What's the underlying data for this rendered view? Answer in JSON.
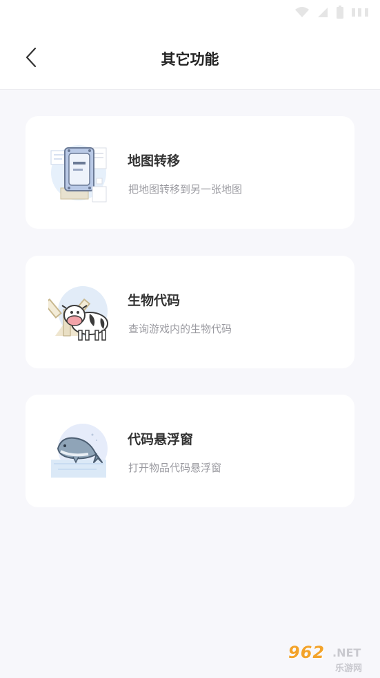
{
  "header": {
    "title": "其它功能"
  },
  "cards": [
    {
      "title": "地图转移",
      "desc": "把地图转移到另一张地图",
      "icon": "map-transfer-illustration"
    },
    {
      "title": "生物代码",
      "desc": "查询游戏内的生物代码",
      "icon": "cow-windmill-illustration"
    },
    {
      "title": "代码悬浮窗",
      "desc": "打开物品代码悬浮窗",
      "icon": "whale-illustration"
    }
  ],
  "watermark": {
    "number": "962",
    "net": ".NET",
    "name": "乐游网"
  },
  "colors": {
    "background": "#f7f7fb",
    "card": "#ffffff",
    "title_text": "#333333",
    "desc_text": "#9a9aa0",
    "watermark": "#f3a32a"
  }
}
